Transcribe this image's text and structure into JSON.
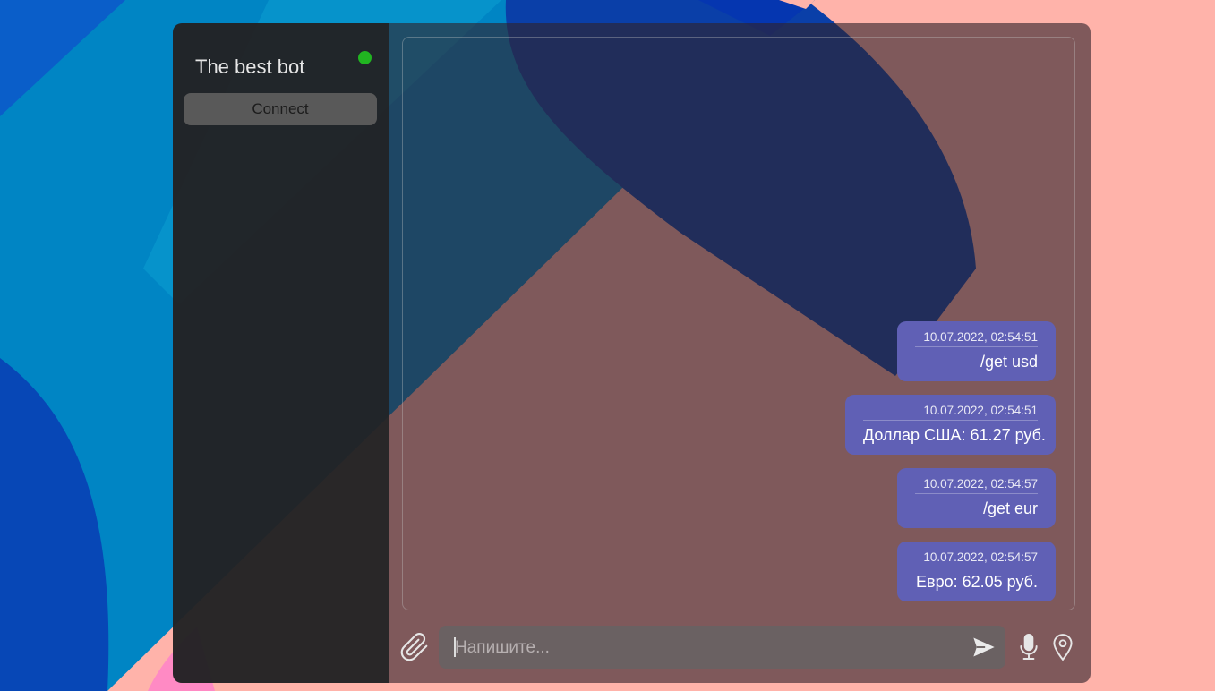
{
  "colors": {
    "status_online": "#21b521",
    "bubble": "#6060b5"
  },
  "sidebar": {
    "bot_name": "The best bot",
    "status": "online",
    "connect_label": "Connect"
  },
  "messages": [
    {
      "time": "10.07.2022, 02:54:51",
      "text": "/get usd"
    },
    {
      "time": "10.07.2022, 02:54:51",
      "text": "Доллар США: 61.27 руб."
    },
    {
      "time": "10.07.2022, 02:54:57",
      "text": "/get eur"
    },
    {
      "time": "10.07.2022, 02:54:57",
      "text": "Евро: 62.05 руб."
    }
  ],
  "composer": {
    "placeholder": "Напишите...",
    "value": "",
    "icons": [
      "paperclip-icon",
      "send-icon",
      "microphone-icon",
      "location-pin-icon"
    ]
  }
}
